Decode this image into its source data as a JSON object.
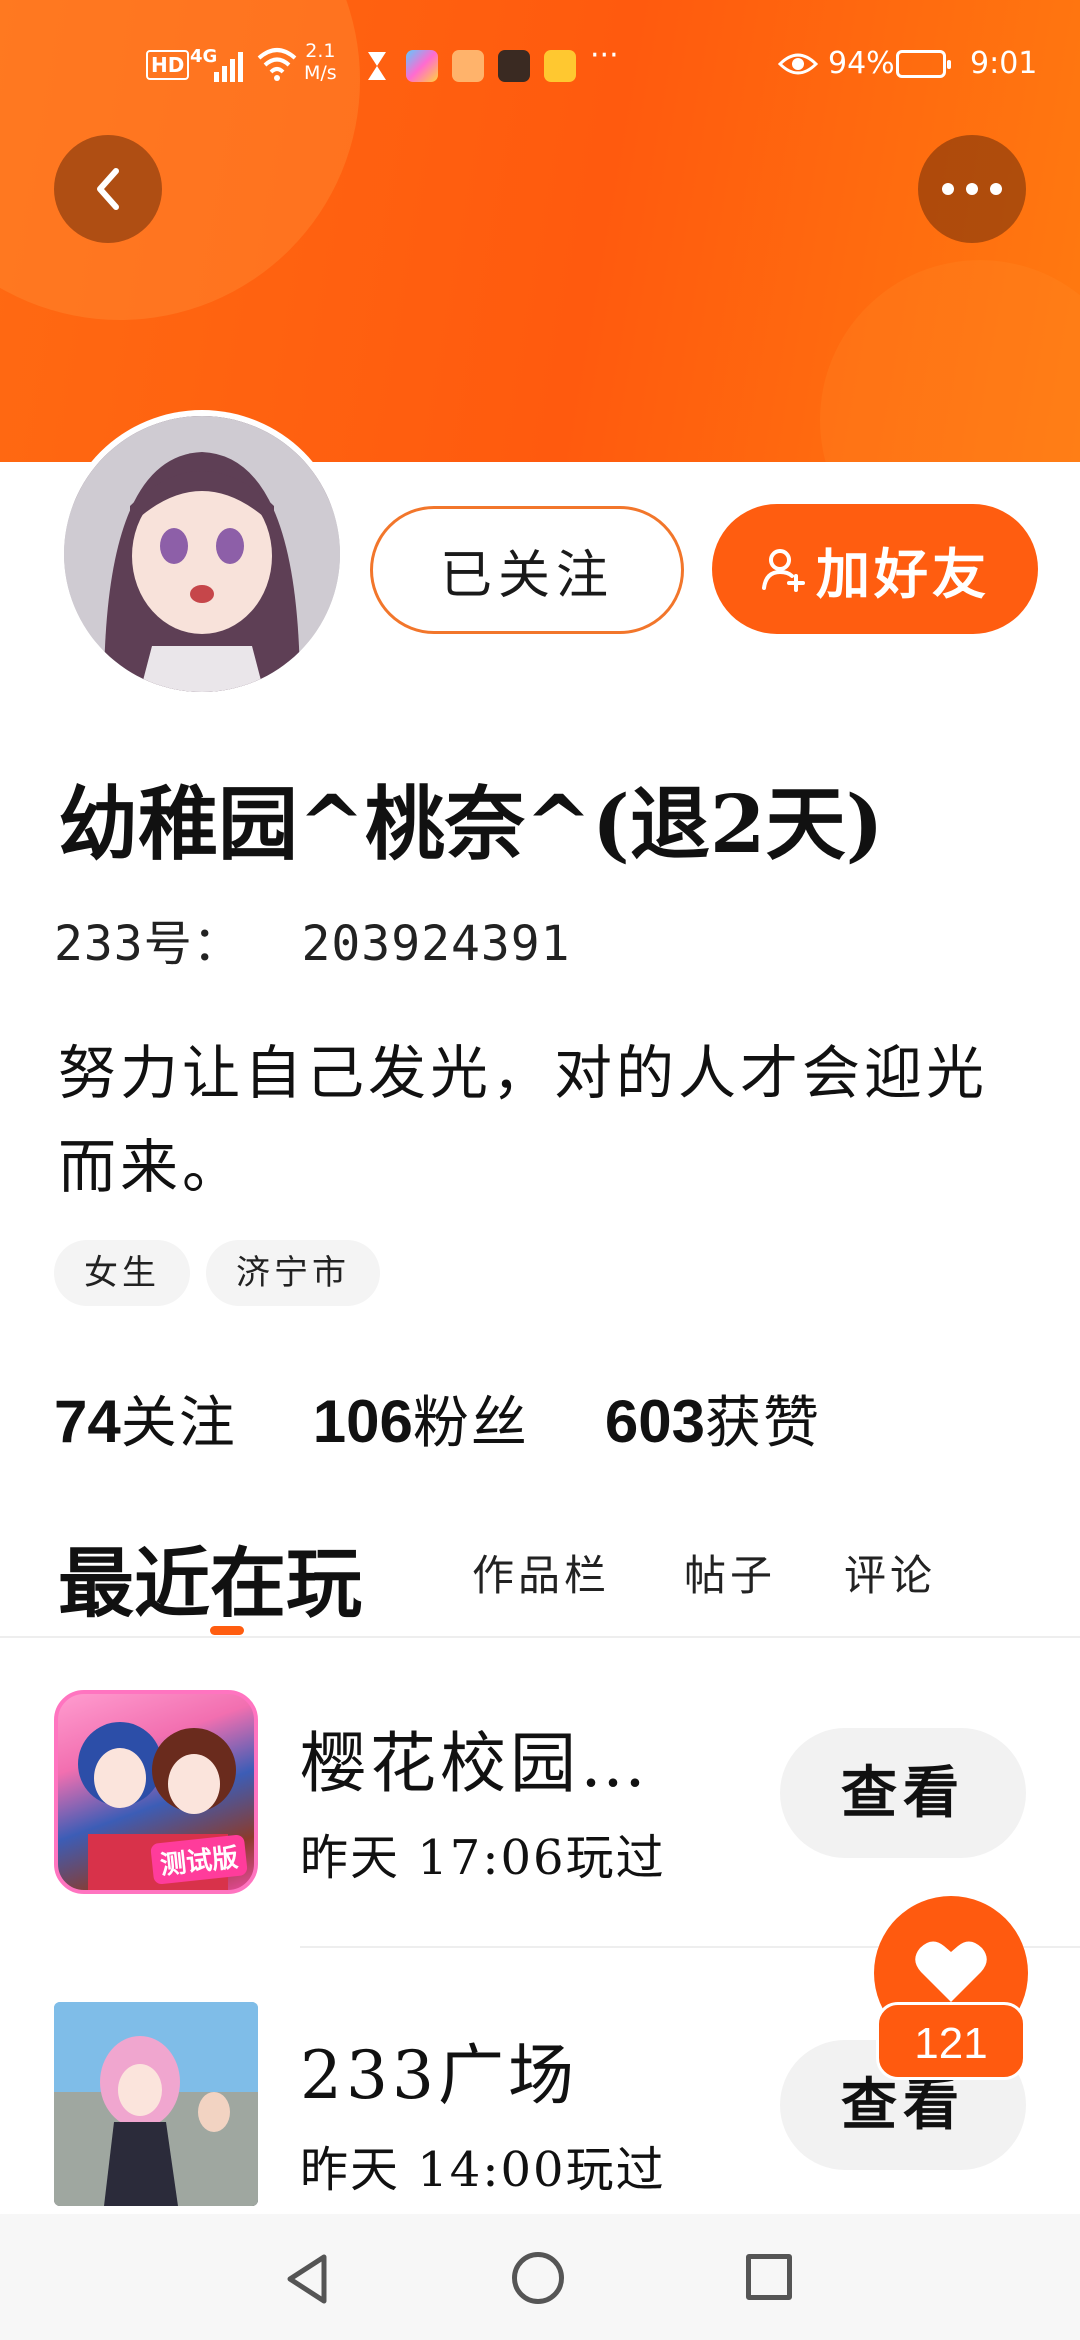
{
  "status_bar": {
    "hd": "HD",
    "network": "4G",
    "speed": "2.1\nM/s",
    "more": "···",
    "battery": "94%",
    "time": "9:01"
  },
  "header": {
    "back_icon": "chevron-left-icon",
    "more_icon": "more-horizontal-icon"
  },
  "profile": {
    "follow_label": "已关注",
    "add_friend_label": "加好友",
    "nickname": "幼稚园^桃奈^(退2天)",
    "user_id": "233号：  203924391",
    "bio": "努力让自己发光，对的人才会迎光而来。",
    "tags": [
      "女生",
      "济宁市"
    ],
    "stats": [
      {
        "num": "74",
        "label": "关注"
      },
      {
        "num": "106",
        "label": "粉丝"
      },
      {
        "num": "603",
        "label": "获赞"
      }
    ]
  },
  "tabs": {
    "active": "最近在玩",
    "items": [
      "作品栏",
      "帖子",
      "评论"
    ]
  },
  "games": [
    {
      "title": "樱花校园…",
      "time": "昨天  17:06玩过",
      "badge": "测试版",
      "action": "查看"
    },
    {
      "title": "233广场",
      "time": "昨天  14:00玩过",
      "action": "查看"
    }
  ],
  "like": {
    "count": "121"
  },
  "colors": {
    "accent": "#ff5d10",
    "header_gradient": [
      "#ff6a12",
      "#ff7a10"
    ],
    "chip_bg": "#f4f4f4"
  }
}
